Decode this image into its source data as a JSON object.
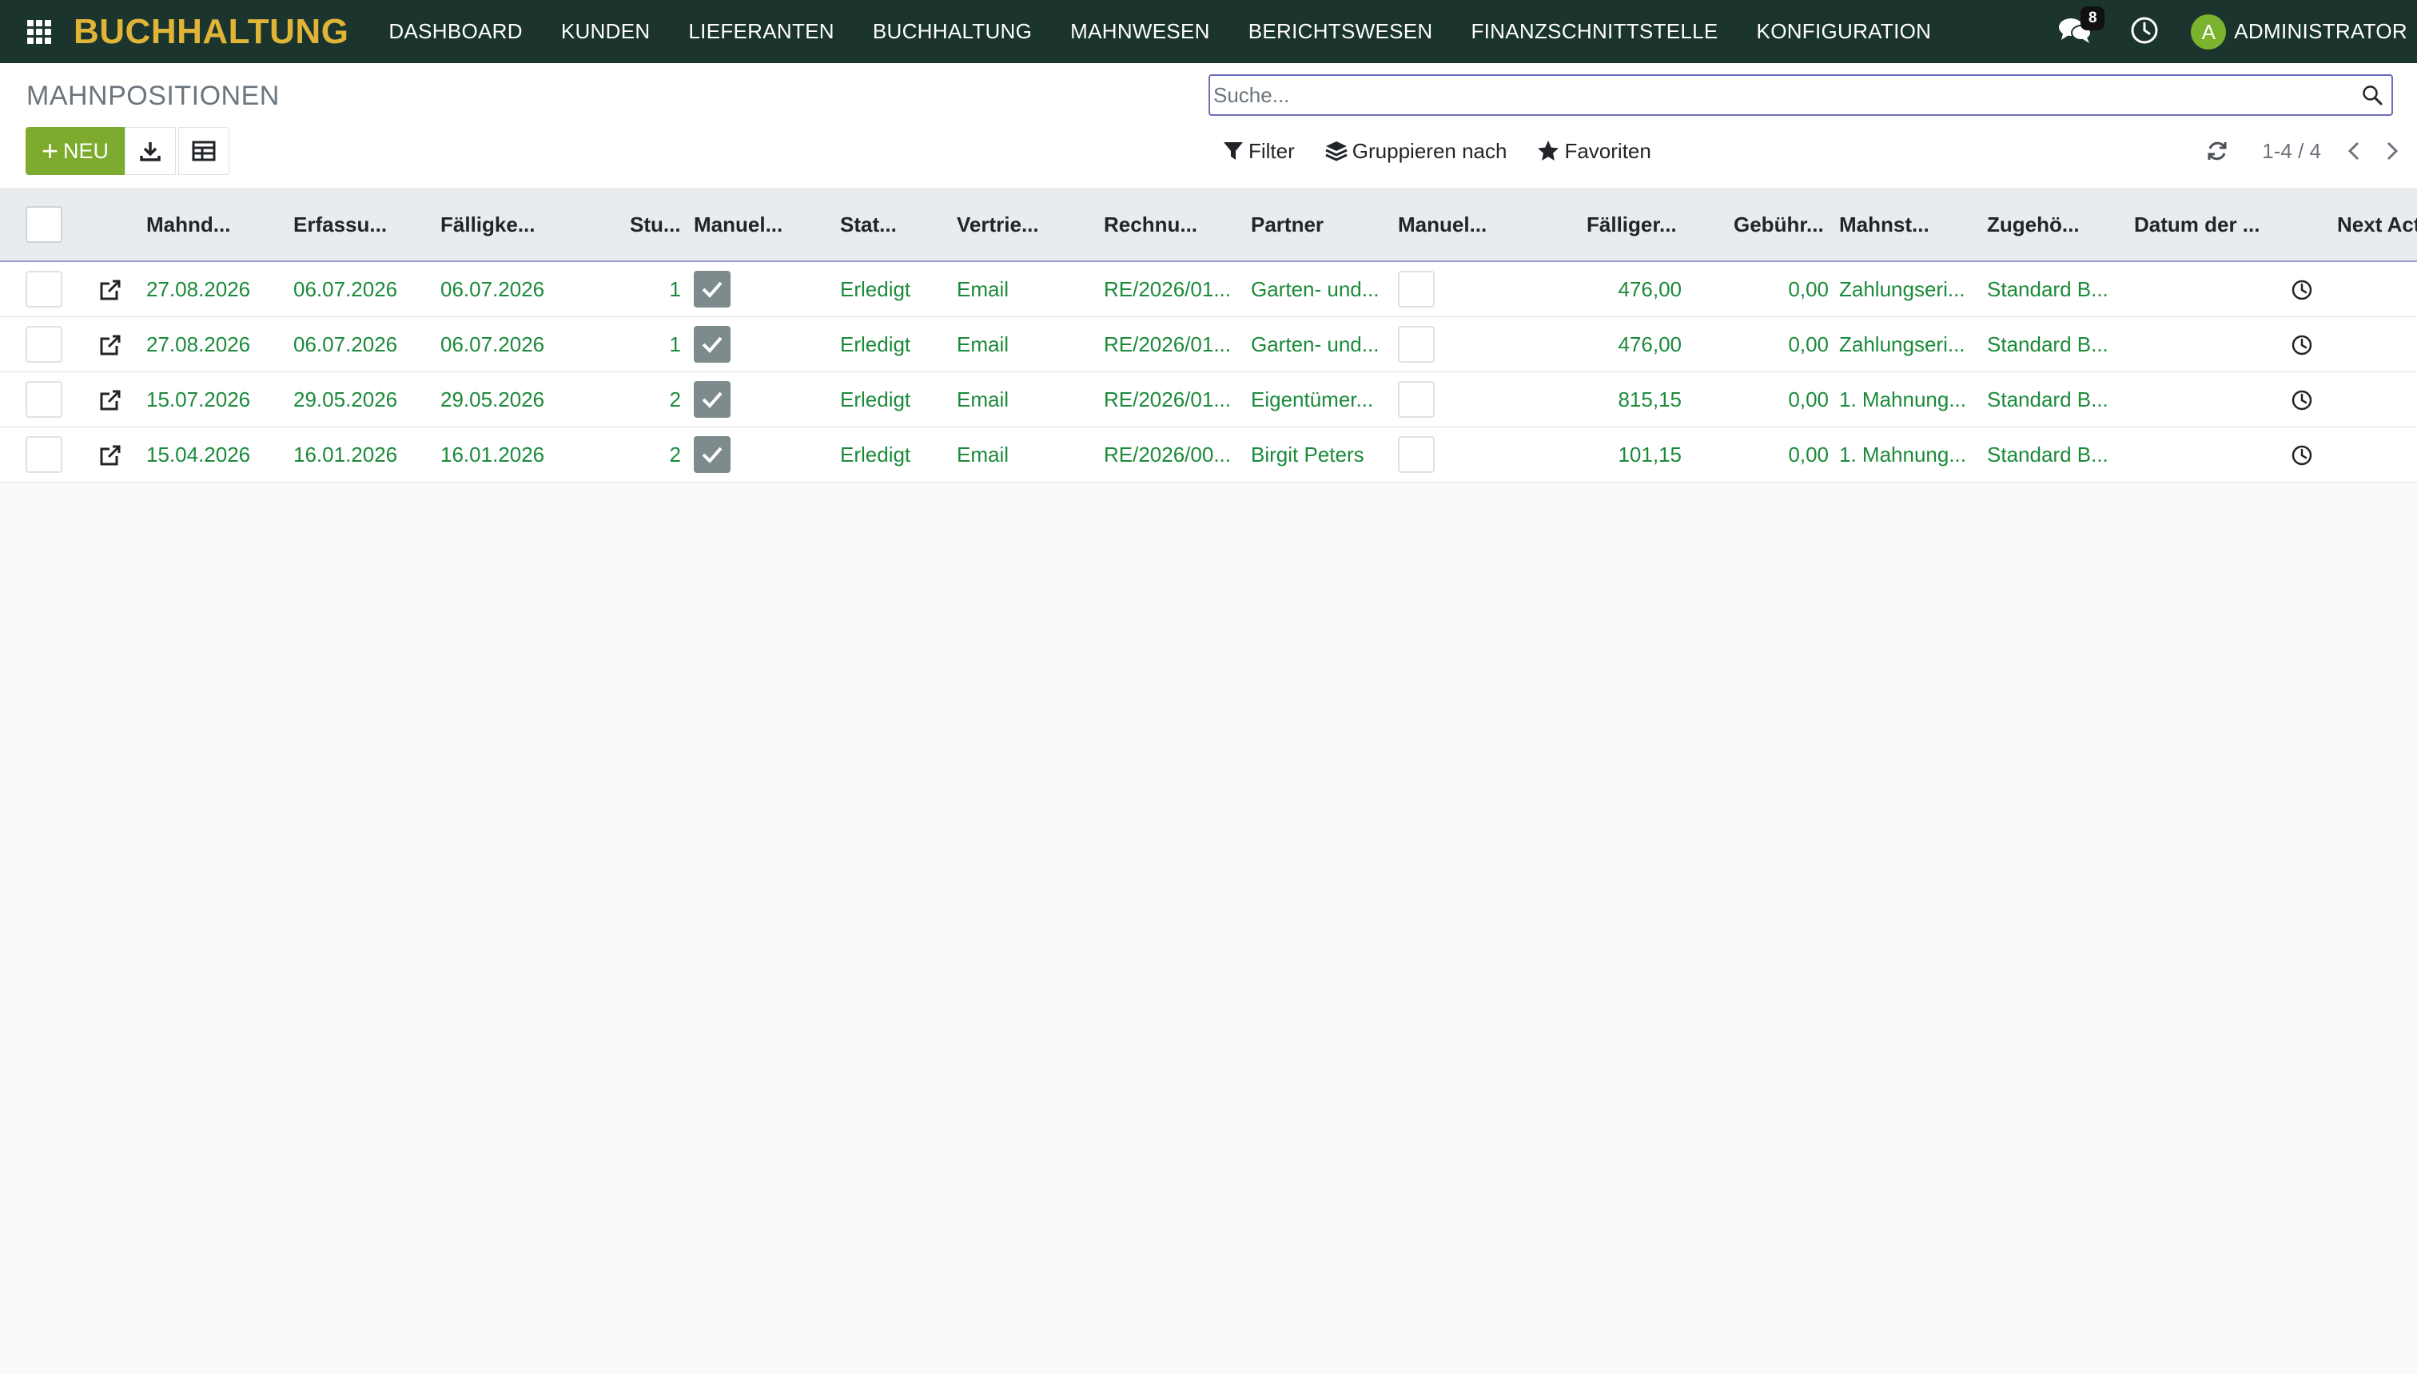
{
  "navbar": {
    "brand": "BUCHHALTUNG",
    "menu": [
      "DASHBOARD",
      "KUNDEN",
      "LIEFERANTEN",
      "BUCHHALTUNG",
      "MAHNWESEN",
      "BERICHTSWESEN",
      "FINANZSCHNITTSTELLE",
      "KONFIGURATION"
    ],
    "messages_count": "8",
    "avatar_letter": "A",
    "user_name": "ADMINISTRATOR"
  },
  "control": {
    "title": "MAHNPOSITIONEN",
    "search_placeholder": "Suche...",
    "new_label": "NEU",
    "filter_label": "Filter",
    "group_label": "Gruppieren nach",
    "favorites_label": "Favoriten",
    "pager": "1-4 / 4"
  },
  "table": {
    "headers": {
      "mahndatum": "Mahnd...",
      "erfassung": "Erfassu...",
      "faelligkeit": "Fälligke...",
      "stufe": "Stu...",
      "manuell": "Manuel...",
      "status": "Stat...",
      "vertrieb": "Vertrie...",
      "rechnung": "Rechnu...",
      "partner": "Partner",
      "manuell2": "Manuel...",
      "faelliger": "Fälliger...",
      "gebuehr": "Gebühr...",
      "mahnstufe": "Mahnst...",
      "zugehoerig": "Zugehö...",
      "datum": "Datum der ...",
      "next": "Next Act"
    },
    "rows": [
      {
        "mahndatum": "27.08.2026",
        "erfassung": "06.07.2026",
        "faelligkeit": "06.07.2026",
        "stufe": "1",
        "manuell": true,
        "status": "Erledigt",
        "vertrieb": "Email",
        "rechnung": "RE/2026/01...",
        "partner": "Garten- und...",
        "manuell2": false,
        "faelliger": "476,00",
        "gebuehr": "0,00",
        "mahnstufe": "Zahlungseri...",
        "zugehoerig": "Standard B..."
      },
      {
        "mahndatum": "27.08.2026",
        "erfassung": "06.07.2026",
        "faelligkeit": "06.07.2026",
        "stufe": "1",
        "manuell": true,
        "status": "Erledigt",
        "vertrieb": "Email",
        "rechnung": "RE/2026/01...",
        "partner": "Garten- und...",
        "manuell2": false,
        "faelliger": "476,00",
        "gebuehr": "0,00",
        "mahnstufe": "Zahlungseri...",
        "zugehoerig": "Standard B..."
      },
      {
        "mahndatum": "15.07.2026",
        "erfassung": "29.05.2026",
        "faelligkeit": "29.05.2026",
        "stufe": "2",
        "manuell": true,
        "status": "Erledigt",
        "vertrieb": "Email",
        "rechnung": "RE/2026/01...",
        "partner": "Eigentümer...",
        "manuell2": false,
        "faelliger": "815,15",
        "gebuehr": "0,00",
        "mahnstufe": "1. Mahnung...",
        "zugehoerig": "Standard B..."
      },
      {
        "mahndatum": "15.04.2026",
        "erfassung": "16.01.2026",
        "faelligkeit": "16.01.2026",
        "stufe": "2",
        "manuell": true,
        "status": "Erledigt",
        "vertrieb": "Email",
        "rechnung": "RE/2026/00...",
        "partner": "Birgit Peters",
        "manuell2": false,
        "faelliger": "101,15",
        "gebuehr": "0,00",
        "mahnstufe": "1. Mahnung...",
        "zugehoerig": "Standard B..."
      }
    ]
  }
}
